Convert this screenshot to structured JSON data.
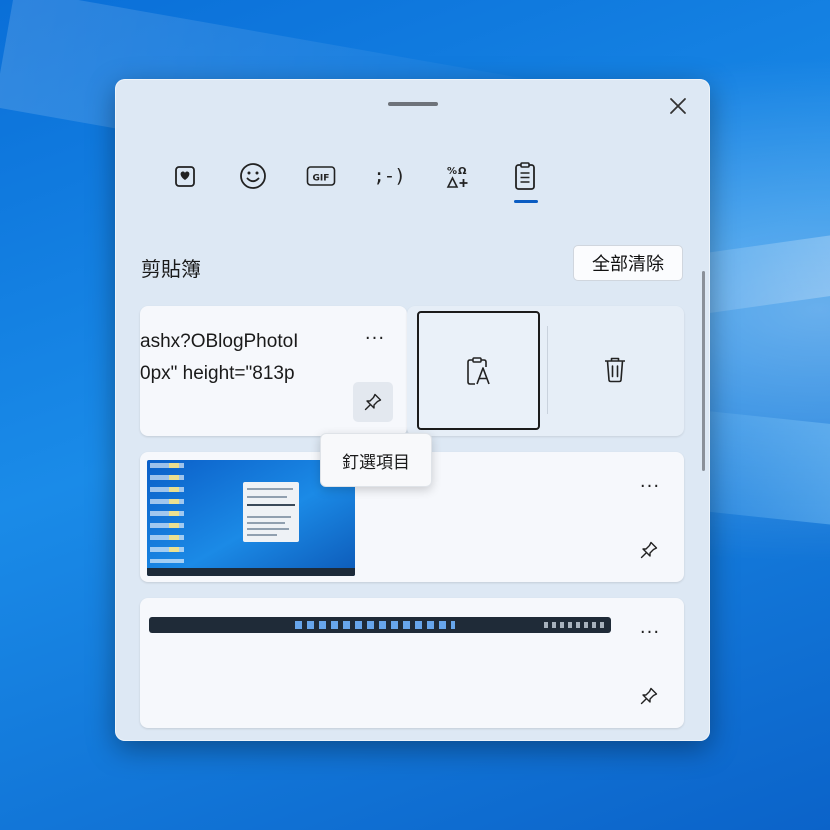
{
  "panel": {
    "close_icon": "close-icon",
    "drag_handle": "grip-bar"
  },
  "tabs": [
    {
      "id": "favorites",
      "icon": "heart-card-icon"
    },
    {
      "id": "emoji",
      "icon": "smiley-icon"
    },
    {
      "id": "gif",
      "icon": "gif-icon",
      "label": "GIF"
    },
    {
      "id": "kaomoji",
      "label": ";-)"
    },
    {
      "id": "symbols",
      "icon": "symbols-icon"
    },
    {
      "id": "clipboard",
      "icon": "clipboard-icon",
      "active": true
    }
  ],
  "clipboard": {
    "title": "剪貼簿",
    "clear_all": "全部清除",
    "items": [
      {
        "type": "text",
        "lines": [
          "ashx?OBlogPhotoI",
          "0px\" height=\"813p"
        ],
        "more": "···",
        "pin_tooltip": "釘選項目"
      },
      {
        "type": "image",
        "thumbnail": "desktop-screenshot",
        "more": "···"
      },
      {
        "type": "image",
        "thumbnail": "taskbar-screenshot",
        "more": "···"
      }
    ],
    "actions": {
      "paste_plain": "paste-as-text-icon",
      "delete": "trash-icon"
    }
  },
  "colors": {
    "accent": "#0a5cc2",
    "panel_bg": "#dde8f4",
    "card_bg": "#f6f8fc"
  }
}
